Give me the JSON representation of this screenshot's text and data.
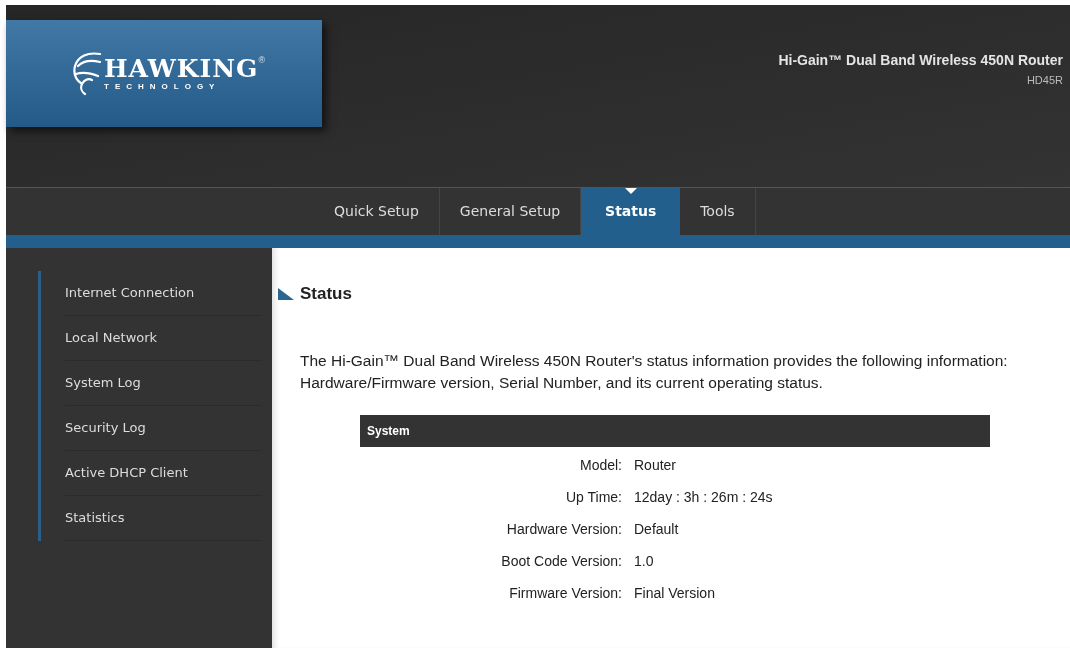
{
  "logo": {
    "name": "HAWKING",
    "registered": "®",
    "tagline": "TECHNOLOGY"
  },
  "product": {
    "title": "Hi-Gain™ Dual Band Wireless 450N Router",
    "model": "HD45R"
  },
  "tabs": [
    {
      "label": "Quick Setup",
      "selected": false
    },
    {
      "label": "General Setup",
      "selected": false
    },
    {
      "label": "Status",
      "selected": true
    },
    {
      "label": "Tools",
      "selected": false
    }
  ],
  "sidebar": {
    "items": [
      {
        "label": "Internet Connection"
      },
      {
        "label": "Local Network"
      },
      {
        "label": "System Log"
      },
      {
        "label": "Security Log"
      },
      {
        "label": "Active DHCP Client"
      },
      {
        "label": "Statistics"
      }
    ]
  },
  "page": {
    "heading": "Status",
    "description": "The Hi-Gain™ Dual Band Wireless 450N Router's status information provides the following information: Hardware/Firmware version, Serial Number, and its current operating status."
  },
  "table": {
    "title": "System",
    "rows": [
      {
        "label": "Model:",
        "value": "Router"
      },
      {
        "label": "Up Time:",
        "value": "12day : 3h : 26m : 24s"
      },
      {
        "label": "Hardware Version:",
        "value": "Default"
      },
      {
        "label": "Boot Code Version:",
        "value": "1.0"
      },
      {
        "label": "Firmware Version:",
        "value": "Final Version"
      }
    ]
  }
}
